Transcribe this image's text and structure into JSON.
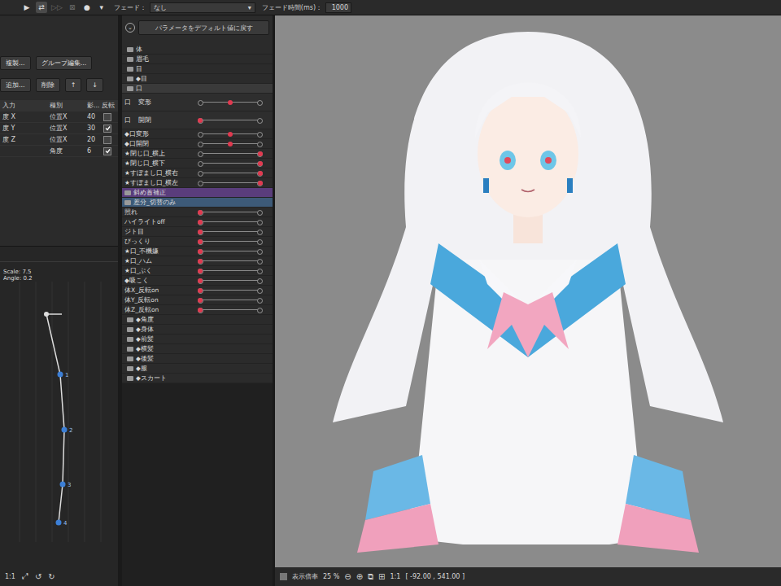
{
  "toolbar": {
    "controls": [
      {
        "icon": "▶",
        "selected": false,
        "disabled": false
      },
      {
        "icon": "⇄",
        "selected": true,
        "disabled": false
      },
      {
        "icon": "▷▷",
        "selected": false,
        "disabled": true
      },
      {
        "icon": "⊠",
        "selected": false,
        "disabled": true
      },
      {
        "icon": "●",
        "selected": false,
        "disabled": false
      },
      {
        "icon": "▾",
        "selected": false,
        "disabled": false
      }
    ],
    "fade": {
      "label": "フェード：",
      "value": "なし",
      "caret": "▾"
    },
    "fade_time": {
      "label": "フェード時間(ms)：",
      "value": "1000"
    }
  },
  "left_panel": {
    "button_rows": [
      [
        "複製...",
        "グループ編集..."
      ],
      [
        "追加...",
        "削除",
        "↑",
        "↓"
      ]
    ],
    "table": {
      "columns": [
        "入力",
        "種別",
        "影...",
        "反転"
      ],
      "rows": [
        {
          "input": "度 X",
          "type": "位置X",
          "influence": "40",
          "invert": false
        },
        {
          "input": "度 Y",
          "type": "位置X",
          "influence": "30",
          "invert": true
        },
        {
          "input": "度 Z",
          "type": "位置X",
          "influence": "20",
          "invert": false
        },
        {
          "input": "",
          "type": "角度",
          "influence": "6",
          "invert": true
        }
      ]
    },
    "physics_graph": {
      "scale": "Scale: 7.5",
      "angle": "Angle: 0.2",
      "points": [
        "1",
        "2",
        "3",
        "4"
      ]
    },
    "footer": {
      "zoom": "1:1",
      "icons": [
        "⤢",
        "↺",
        "↻"
      ]
    }
  },
  "parameter_panel": {
    "toggle_icon": "⌄",
    "reset_button": "パラメータをデフォルト値に戻す",
    "items": [
      {
        "kind": "folder",
        "label": "体",
        "selected": false
      },
      {
        "kind": "folder",
        "label": "眉毛",
        "selected": false
      },
      {
        "kind": "folder",
        "label": "目",
        "selected": false
      },
      {
        "kind": "folder",
        "label": "◆目",
        "selected": false
      },
      {
        "kind": "folder",
        "label": "口",
        "selected": true
      },
      {
        "kind": "keyparam",
        "prefix": "口",
        "label": "変形",
        "level": 0.5
      },
      {
        "kind": "keyparam",
        "prefix": "口",
        "label": "開閉",
        "level": 0
      },
      {
        "kind": "param",
        "label": "◆口変形",
        "level": 0.5
      },
      {
        "kind": "param",
        "label": "◆口開閉",
        "level": 0.5
      },
      {
        "kind": "param",
        "label": "★閉じ口_横上",
        "level": 1
      },
      {
        "kind": "param",
        "label": "★閉じ口_横下",
        "level": 1
      },
      {
        "kind": "param",
        "label": "★すぼまし口_横右",
        "level": 1
      },
      {
        "kind": "param",
        "label": "★すぼまし口_横左",
        "level": 1
      },
      {
        "kind": "group",
        "label": "斜め首補正",
        "color": "#5a3d7c"
      },
      {
        "kind": "group",
        "label": "差分_切替のみ",
        "color": "#3d5a78"
      },
      {
        "kind": "param",
        "label": "照れ",
        "level": 0
      },
      {
        "kind": "param",
        "label": "ハイライトoff",
        "level": 0
      },
      {
        "kind": "param",
        "label": "ジト目",
        "level": 0
      },
      {
        "kind": "param",
        "label": "びっくり",
        "level": 0
      },
      {
        "kind": "param",
        "label": "★口_不機嫌",
        "level": 0
      },
      {
        "kind": "param",
        "label": "★口_ハム",
        "level": 0
      },
      {
        "kind": "param",
        "label": "★口_ぷく",
        "level": 0
      },
      {
        "kind": "param",
        "label": "◆吸こく",
        "level": 0
      },
      {
        "kind": "param",
        "label": "体X_反転on",
        "level": 0
      },
      {
        "kind": "param",
        "label": "体Y_反転on",
        "level": 0
      },
      {
        "kind": "param",
        "label": "体Z_反転on",
        "level": 0
      },
      {
        "kind": "folder",
        "label": "◆角度",
        "selected": false
      },
      {
        "kind": "folder",
        "label": "◆身体",
        "selected": false
      },
      {
        "kind": "folder",
        "label": "◆前髪",
        "selected": false
      },
      {
        "kind": "folder",
        "label": "◆横髪",
        "selected": false
      },
      {
        "kind": "folder",
        "label": "◆後髪",
        "selected": false
      },
      {
        "kind": "folder",
        "label": "◆服",
        "selected": false
      },
      {
        "kind": "folder",
        "label": "◆スカート",
        "selected": false
      }
    ]
  },
  "canvas": {
    "footer": {
      "zoom_label": "表示倍率",
      "zoom_value": "25 %",
      "icons": [
        "⊖",
        "⊕",
        "⧉",
        "⊞"
      ],
      "fit": "1:1",
      "coords": "[ -92.00 , 541.00 ]"
    }
  }
}
